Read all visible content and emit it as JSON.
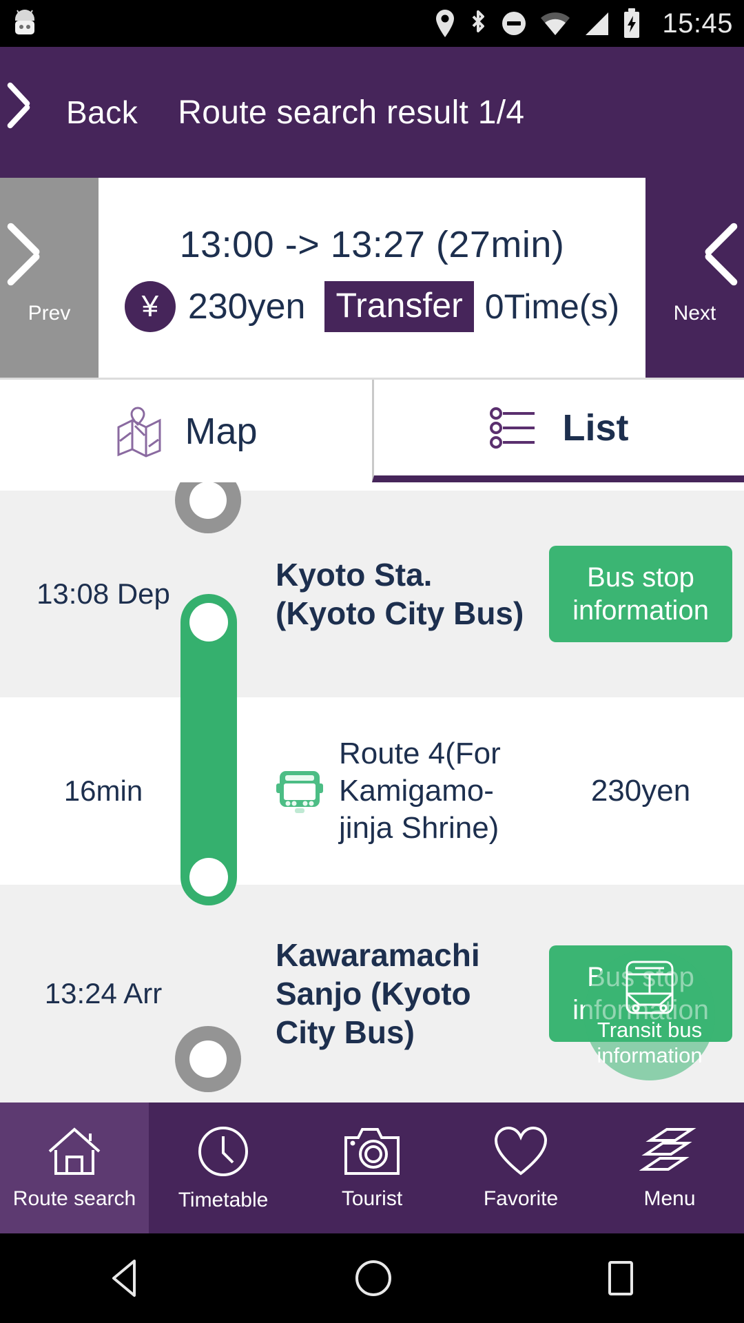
{
  "status_bar": {
    "time": "15:45",
    "icons": [
      "android-mascot-icon",
      "location-pin-icon",
      "bluetooth-icon",
      "do-not-disturb-icon",
      "wifi-icon",
      "cellular-signal-icon",
      "battery-charging-icon"
    ]
  },
  "app_bar": {
    "back_label": "Back",
    "title": "Route search result 1/4",
    "back_icon": "chevron-left-icon"
  },
  "summary": {
    "prev_label": "Prev",
    "next_label": "Next",
    "prev_icon": "chevron-left-icon",
    "next_icon": "chevron-right-icon",
    "time_range": "13:00 -> 13:27 (27min)",
    "currency_symbol": "¥",
    "fare": "230yen",
    "transfer_label": "Transfer",
    "transfer_count": "0Time(s)"
  },
  "tabs": [
    {
      "label": "Map",
      "icon": "map-icon",
      "active": false
    },
    {
      "label": "List",
      "icon": "list-icon",
      "active": true
    }
  ],
  "itinerary": {
    "rows": [
      {
        "kind": "stop",
        "time": "13:08 Dep",
        "name": "Kyoto Sta. (Kyoto City Bus)",
        "action_label": "Bus stop information"
      },
      {
        "kind": "leg",
        "duration": "16min",
        "route": "Route 4(For Kamigamo-jinja Shrine)",
        "fare": "230yen",
        "icon": "bus-icon"
      },
      {
        "kind": "stop",
        "time": "13:24 Arr",
        "name": "Kawaramachi Sanjo (Kyoto City Bus)",
        "action_label": "Bus stop information"
      }
    ]
  },
  "floating_action": {
    "label": "Transit bus information",
    "icon": "transit-bus-icon"
  },
  "bottom_nav": [
    {
      "label": "Route search",
      "icon": "home-icon",
      "active": true
    },
    {
      "label": "Timetable",
      "icon": "clock-icon",
      "active": false
    },
    {
      "label": "Tourist",
      "icon": "camera-icon",
      "active": false
    },
    {
      "label": "Favorite",
      "icon": "heart-icon",
      "active": false
    },
    {
      "label": "Menu",
      "icon": "layers-icon",
      "active": false
    }
  ],
  "android_nav": [
    {
      "icon": "back-triangle-icon"
    },
    {
      "icon": "home-circle-icon"
    },
    {
      "icon": "recents-square-icon"
    }
  ],
  "colors": {
    "brand_purple": "#46255a",
    "brand_purple_light": "#5d3a71",
    "accent_green": "#3bb573",
    "text_navy": "#1d2f4e",
    "row_shade": "#f0f0f0",
    "gray": "#949494"
  }
}
